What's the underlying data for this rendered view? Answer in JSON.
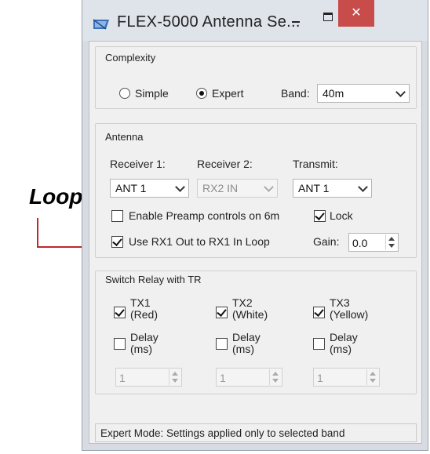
{
  "annotation": {
    "label": "Loop",
    "line_color": "#c0282e"
  },
  "window": {
    "title": "FLEX-5000 Antenna Se...",
    "close_symbol": "✕",
    "icons": [
      "app-icon",
      "minimize-icon",
      "maximize-icon",
      "close-icon"
    ]
  },
  "complexity": {
    "legend": "Complexity",
    "simple_label": "Simple",
    "expert_label": "Expert",
    "selected": "Expert",
    "band_label": "Band:",
    "band_value": "40m"
  },
  "antenna": {
    "legend": "Antenna",
    "receiver1_label": "Receiver 1:",
    "receiver1_value": "ANT 1",
    "receiver2_label": "Receiver 2:",
    "receiver2_value": "RX2 IN",
    "transmit_label": "Transmit:",
    "transmit_value": "ANT 1",
    "preamp_label": "Enable Preamp controls on 6m",
    "preamp_checked": false,
    "lock_label": "Lock",
    "lock_checked": true,
    "rx1_loop_label": "Use RX1 Out to RX1 In Loop",
    "rx1_loop_checked": true,
    "gain_label": "Gain:",
    "gain_value": "0.0"
  },
  "switch_relay": {
    "legend": "Switch Relay with TR",
    "tx": [
      {
        "line1": "TX1",
        "line2": "(Red)",
        "checked": true
      },
      {
        "line1": "TX2",
        "line2": "(White)",
        "checked": true
      },
      {
        "line1": "TX3",
        "line2": "(Yellow)",
        "checked": true
      }
    ],
    "delay": [
      {
        "line1": "Delay",
        "line2": "(ms)",
        "checked": false,
        "value": "1"
      },
      {
        "line1": "Delay",
        "line2": "(ms)",
        "checked": false,
        "value": "1"
      },
      {
        "line1": "Delay",
        "line2": "(ms)",
        "checked": false,
        "value": "1"
      }
    ]
  },
  "status": {
    "text": "Expert Mode: Settings applied only to selected band"
  }
}
